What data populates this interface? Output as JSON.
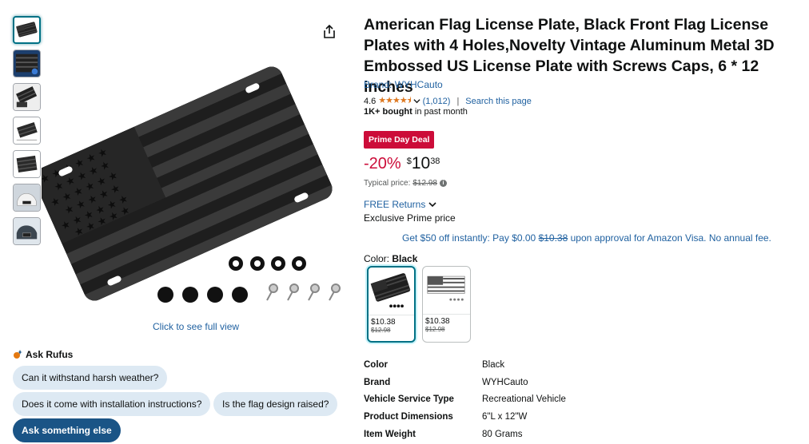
{
  "product": {
    "title": "American Flag License Plate, Black Front Flag License Plates with 4 Holes,Novelty Vintage Aluminum Metal 3D Embossed US License Plate with Screws Caps, 6 * 12 inches",
    "brand_link": "Brand: WYHCauto",
    "rating": "4.6",
    "stars": "★★★★⯨",
    "rating_count": "(1,012)",
    "search_page": "Search this page",
    "bought_bold": "1K+ bought",
    "bought_rest": " in past month"
  },
  "pricing": {
    "deal_badge": "Prime Day Deal",
    "discount": "-20%",
    "currency": "$",
    "whole": "10",
    "fraction": "38",
    "typical_label": "Typical price: ",
    "typical_value": "$12.98",
    "free_returns": "FREE Returns",
    "prime_price": "Exclusive Prime price",
    "visa_pre": "Get $50 off instantly: Pay $0.00 ",
    "visa_strike": "$10.38",
    "visa_post": " upon approval for Amazon Visa. No annual fee."
  },
  "variants": {
    "label": "Color: ",
    "selected": "Black",
    "options": [
      {
        "price": "$10.38",
        "old_price": "$12.98"
      },
      {
        "price": "$10.38",
        "old_price": "$12.98"
      }
    ]
  },
  "details": [
    {
      "key": "Color",
      "value": "Black"
    },
    {
      "key": "Brand",
      "value": "WYHCauto"
    },
    {
      "key": "Vehicle Service Type",
      "value": "Recreational Vehicle"
    },
    {
      "key": "Product Dimensions",
      "value": "6\"L x 12\"W"
    },
    {
      "key": "Item Weight",
      "value": "80 Grams"
    }
  ],
  "gallery": {
    "full_view": "Click to see full view"
  },
  "rufus": {
    "title": "Ask Rufus",
    "chips": [
      "Can it withstand harsh weather?",
      "Does it come with installation instructions?",
      "Is the flag design raised?",
      "Ask something else"
    ]
  },
  "colors": {
    "link": "#2162a1",
    "deal": "#cc0c39",
    "star": "#de7921",
    "selected_border": "#007185"
  }
}
